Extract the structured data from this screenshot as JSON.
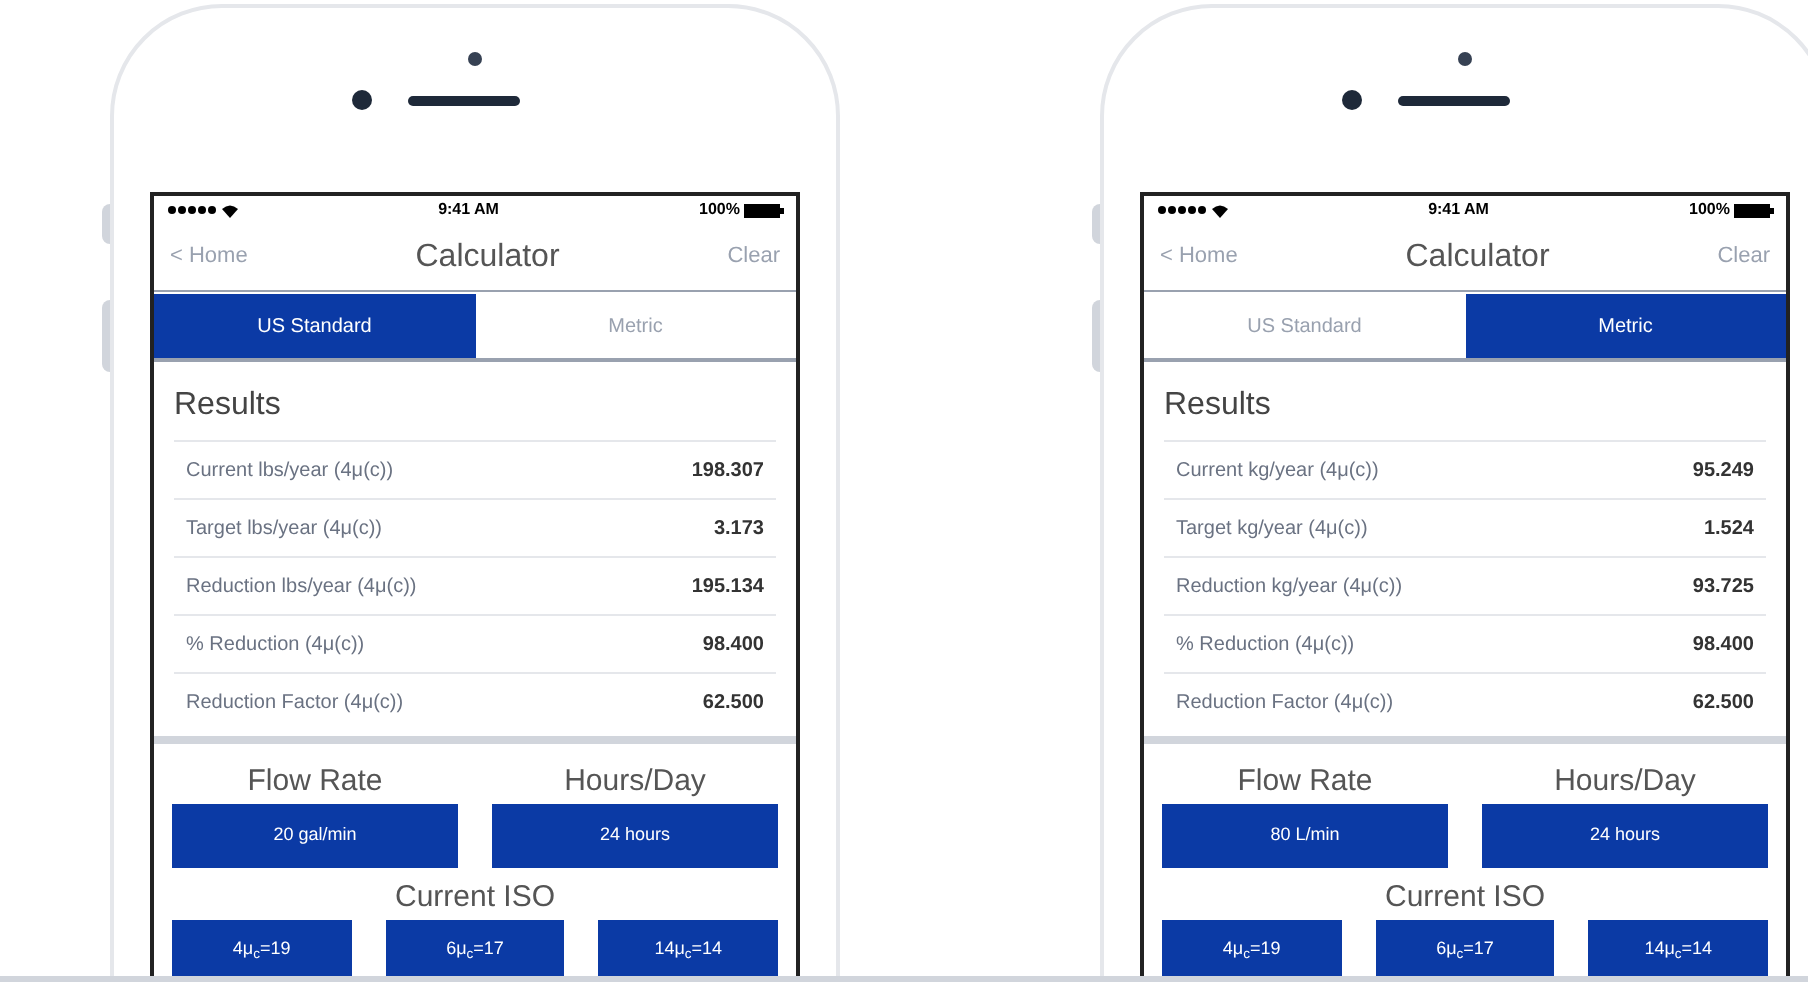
{
  "phones": [
    {
      "status": {
        "time": "9:41 AM",
        "battery": "100%"
      },
      "nav": {
        "back": "< Home",
        "title": "Calculator",
        "action": "Clear"
      },
      "tabs": [
        {
          "label": "US Standard",
          "selected": true
        },
        {
          "label": "Metric",
          "selected": false
        }
      ],
      "results": {
        "title": "Results",
        "rows": [
          {
            "label": "Current lbs/year (4μ(c))",
            "value": "198.307"
          },
          {
            "label": "Target lbs/year (4μ(c))",
            "value": "3.173"
          },
          {
            "label": "Reduction lbs/year (4μ(c))",
            "value": "195.134"
          },
          {
            "label": "% Reduction (4μ(c))",
            "value": "98.400"
          },
          {
            "label": "Reduction Factor (4μ(c))",
            "value": "62.500"
          }
        ]
      },
      "inputs": [
        {
          "label": "Flow Rate",
          "value": "20 gal/min"
        },
        {
          "label": "Hours/Day",
          "value": "24 hours"
        }
      ],
      "iso": {
        "label": "Current ISO",
        "buttons": [
          "4μ$_{c}$=19",
          "6μ$_{c}$=17",
          "14μ$_{c}$=14"
        ]
      }
    },
    {
      "status": {
        "time": "9:41 AM",
        "battery": "100%"
      },
      "nav": {
        "back": "< Home",
        "title": "Calculator",
        "action": "Clear"
      },
      "tabs": [
        {
          "label": "US Standard",
          "selected": false
        },
        {
          "label": "Metric",
          "selected": true
        }
      ],
      "results": {
        "title": "Results",
        "rows": [
          {
            "label": "Current kg/year (4μ(c))",
            "value": "95.249"
          },
          {
            "label": "Target kg/year (4μ(c))",
            "value": "1.524"
          },
          {
            "label": "Reduction kg/year (4μ(c))",
            "value": "93.725"
          },
          {
            "label": "% Reduction (4μ(c))",
            "value": "98.400"
          },
          {
            "label": "Reduction Factor (4μ(c))",
            "value": "62.500"
          }
        ]
      },
      "inputs": [
        {
          "label": "Flow Rate",
          "value": "80 L/min"
        },
        {
          "label": "Hours/Day",
          "value": "24 hours"
        }
      ],
      "iso": {
        "label": "Current ISO",
        "buttons": [
          "4μ$_{c}$=19",
          "6μ$_{c}$=17",
          "14μ$_{c}$=14"
        ]
      }
    }
  ]
}
